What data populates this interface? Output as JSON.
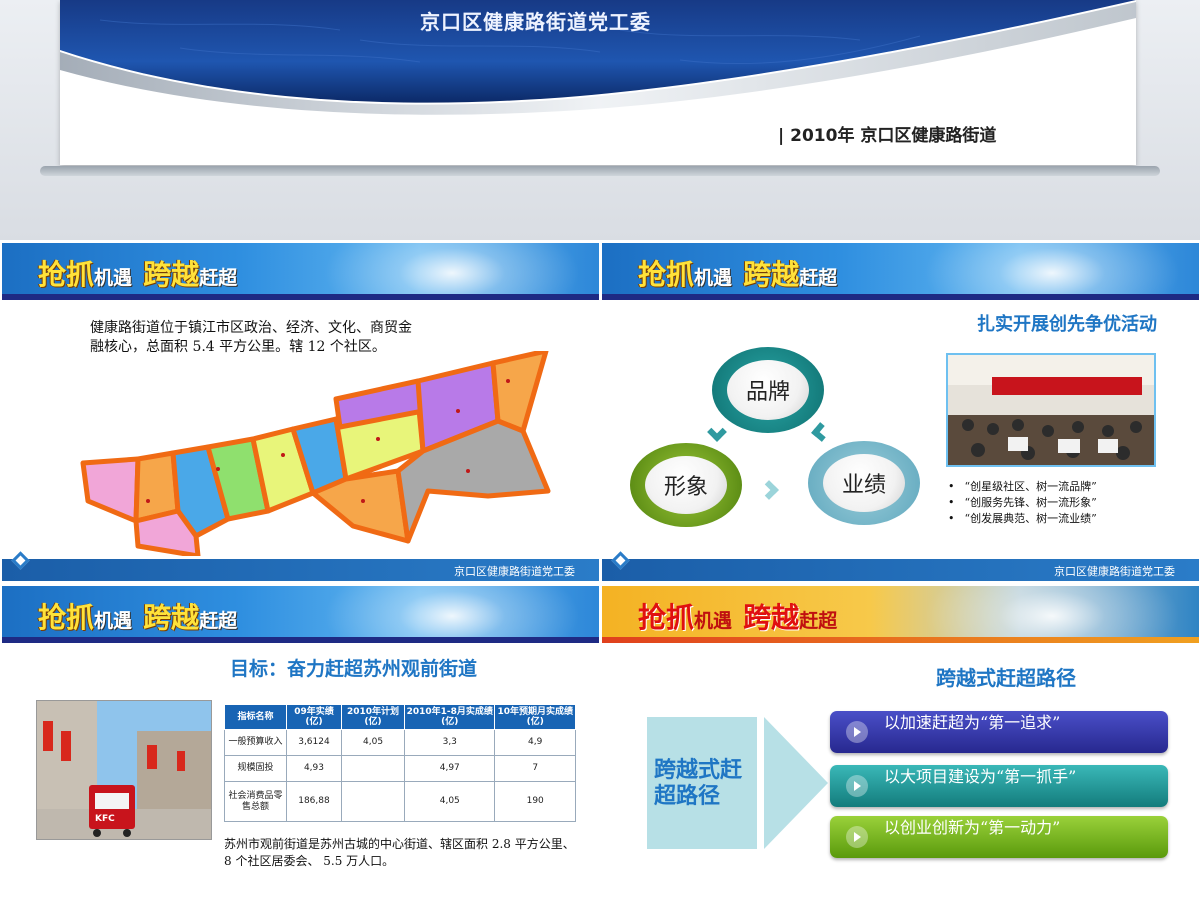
{
  "cover": {
    "title": "京口区健康路街道党工委",
    "date_line": "| 2010年  京口区健康路街道"
  },
  "banner": {
    "big1": "抢抓",
    "small1": "机遇",
    "big2": "跨越",
    "small2": "赶超"
  },
  "footer_text": "京口区健康路街道党工委",
  "slide1": {
    "description": "健康路街道位于镇江市区政治、经济、文化、商贸金融核心，总面积 5.4 平方公里。辖 12 个社区。"
  },
  "slide2": {
    "subtitle": "扎实开展创先争优活动",
    "circles": [
      "品牌",
      "形象",
      "业绩"
    ],
    "bullets": [
      "“创星级社区、树一流品牌”",
      "“创服务先锋、树一流形象”",
      "“创发展典范、树一流业绩”"
    ]
  },
  "slide3": {
    "subtitle": "目标：奋力赶超苏州观前街道",
    "table": {
      "headers": [
        "指标名称",
        "09年实绩(亿)",
        "2010年计划(亿)",
        "2010年1-8月实成绩(亿)",
        "10年预期月实成绩(亿)"
      ],
      "rows": [
        [
          "一般预算收入",
          "3,6124",
          "4,05",
          "3,3",
          "4,9"
        ],
        [
          "规模固投",
          "4,93",
          "",
          "4,97",
          "7"
        ],
        [
          "社会消费品零售总额",
          "186,88",
          "",
          "4,05",
          "190"
        ]
      ]
    },
    "note": "苏州市观前街道是苏州古城的中心街道、辖区面积 2.8 平方公里、 8 个社区居委会、 5.5 万人口。",
    "photo_sign": "KFC"
  },
  "slide4": {
    "subtitle": "跨越式赶超路径",
    "left_label": "跨越式赶超路径",
    "items": [
      "以加速赶超为“第一追求”",
      "以大项目建设为“第一抓手”",
      "以创业创新为“第一动力”"
    ]
  },
  "colors": {
    "accent_blue": "#1f76c4",
    "banner_yellow": "#ffe23a",
    "banner_red": "#e01010",
    "footer_blue": "#1b5ea8"
  }
}
